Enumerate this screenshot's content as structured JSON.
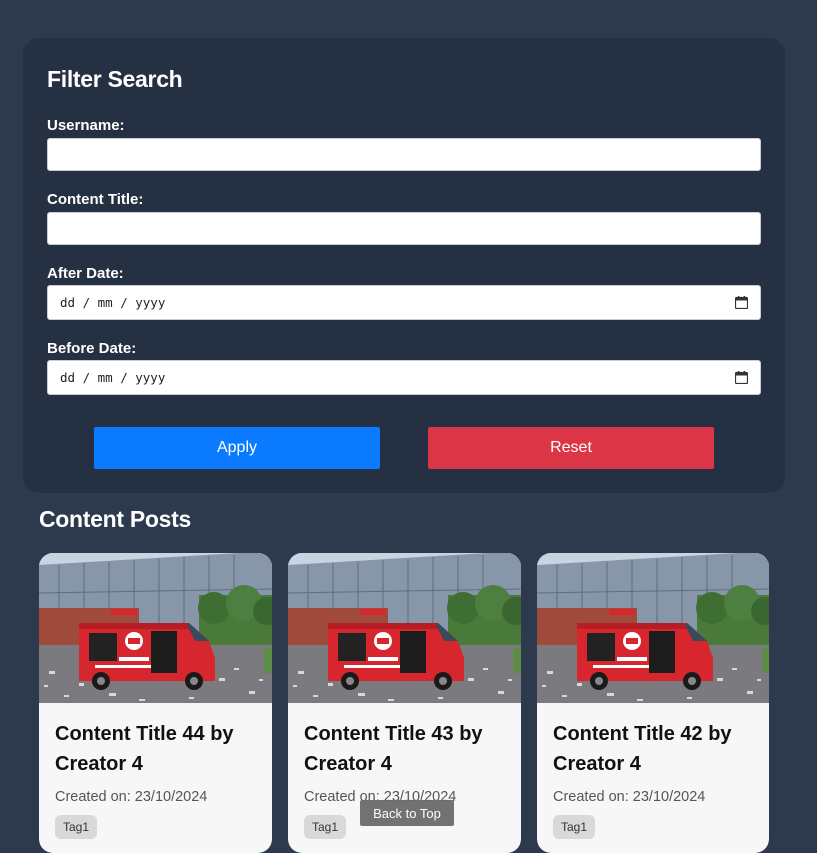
{
  "filter": {
    "title": "Filter Search",
    "username_label": "Username:",
    "username_value": "",
    "content_title_label": "Content Title:",
    "content_title_value": "",
    "after_date_label": "After Date:",
    "after_date_placeholder": "dd / mm / yyyy",
    "before_date_label": "Before Date:",
    "before_date_placeholder": "dd / mm / yyyy",
    "apply_label": "Apply",
    "reset_label": "Reset"
  },
  "posts": {
    "heading": "Content Posts",
    "items": [
      {
        "title": "Content Title 44 by Creator 4",
        "date": "Created on: 23/10/2024",
        "tag": "Tag1"
      },
      {
        "title": "Content Title 43 by Creator 4",
        "date": "Created on: 23/10/2024",
        "tag": "Tag1"
      },
      {
        "title": "Content Title 42 by Creator 4",
        "date": "Created on: 23/10/2024",
        "tag": "Tag1"
      }
    ]
  },
  "back_to_top_label": "Back to Top",
  "icons": {
    "date_picker": "calendar-icon",
    "post_image": "van-photo"
  },
  "colors": {
    "background": "#2d3a4d",
    "panel": "#253142",
    "apply": "#0a7bff",
    "reset": "#dc3545",
    "card": "#f7f7f7",
    "tag": "#d9d9d9"
  }
}
